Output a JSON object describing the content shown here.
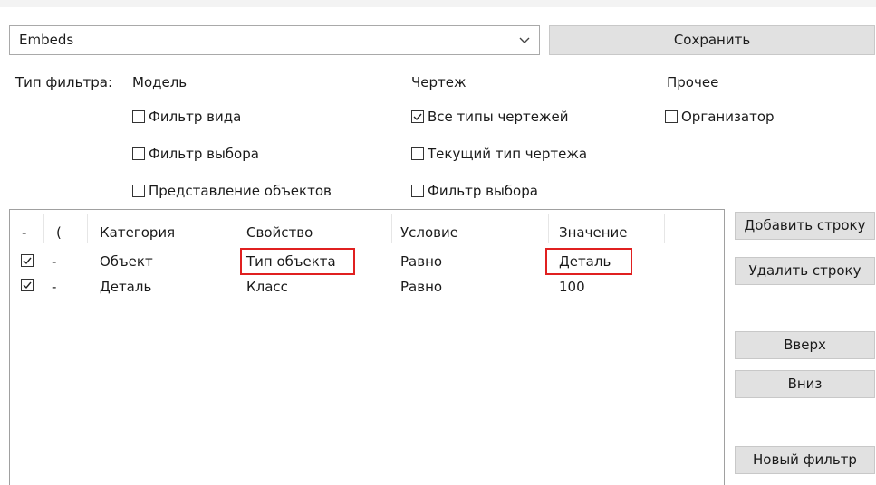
{
  "preset": {
    "selected": "Embeds"
  },
  "buttons": {
    "save": "Сохранить",
    "add_row": "Добавить строку",
    "delete_row": "Удалить строку",
    "up": "Вверх",
    "down": "Вниз",
    "new_filter": "Новый фильтр"
  },
  "filter_type": {
    "label": "Тип фильтра:",
    "model": {
      "heading": "Модель",
      "options": [
        {
          "label": "Фильтр вида",
          "checked": false
        },
        {
          "label": "Фильтр выбора",
          "checked": false
        },
        {
          "label": "Представление объектов",
          "checked": false
        }
      ]
    },
    "drawing": {
      "heading": "Чертеж",
      "options": [
        {
          "label": "Все типы чертежей",
          "checked": true
        },
        {
          "label": "Текущий тип чертежа",
          "checked": false
        },
        {
          "label": "Фильтр выбора",
          "checked": false
        }
      ]
    },
    "other": {
      "heading": "Прочее",
      "options": [
        {
          "label": "Организатор",
          "checked": false
        }
      ]
    }
  },
  "grid": {
    "columns": [
      "-",
      "(",
      "Категория",
      "Свойство",
      "Условие",
      "Значение"
    ],
    "rows": [
      {
        "enabled": true,
        "dash": "-",
        "category": "Объект",
        "property": "Тип объекта",
        "condition": "Равно",
        "value": "Деталь"
      },
      {
        "enabled": true,
        "dash": "-",
        "category": "Деталь",
        "property": "Класс",
        "condition": "Равно",
        "value": "100"
      }
    ]
  },
  "colors": {
    "highlight": "#e02020",
    "button_bg": "#e1e1e1"
  }
}
